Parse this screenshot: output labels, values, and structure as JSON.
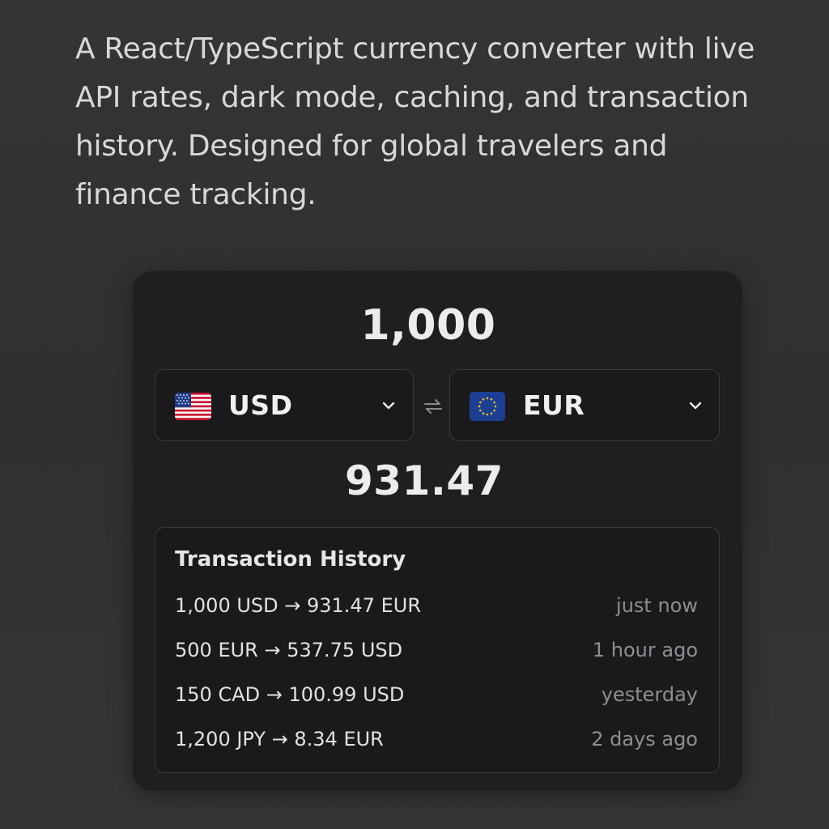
{
  "description": "A React/TypeScript currency converter with live API rates, dark mode, caching, and transaction history. Designed for global travelers and finance tracking.",
  "converter": {
    "amount": "1,000",
    "from": {
      "code": "USD",
      "flag_icon": "us-flag-icon"
    },
    "to": {
      "code": "EUR",
      "flag_icon": "eu-flag-icon"
    },
    "result": "931.47"
  },
  "history": {
    "title": "Transaction History",
    "rows": [
      {
        "text": "1,000 USD → 931.47 EUR",
        "time": "just now"
      },
      {
        "text": "500 EUR → 537.75 USD",
        "time": "1 hour ago"
      },
      {
        "text": "150 CAD → 100.99 USD",
        "time": "yesterday"
      },
      {
        "text": "1,200 JPY → 8.34 EUR",
        "time": "2 days ago"
      }
    ]
  },
  "colors": {
    "background": "#333335",
    "card": "#1f1f21",
    "panel": "#1a1a1c",
    "text": "#ececee",
    "muted": "#8d8d92"
  }
}
